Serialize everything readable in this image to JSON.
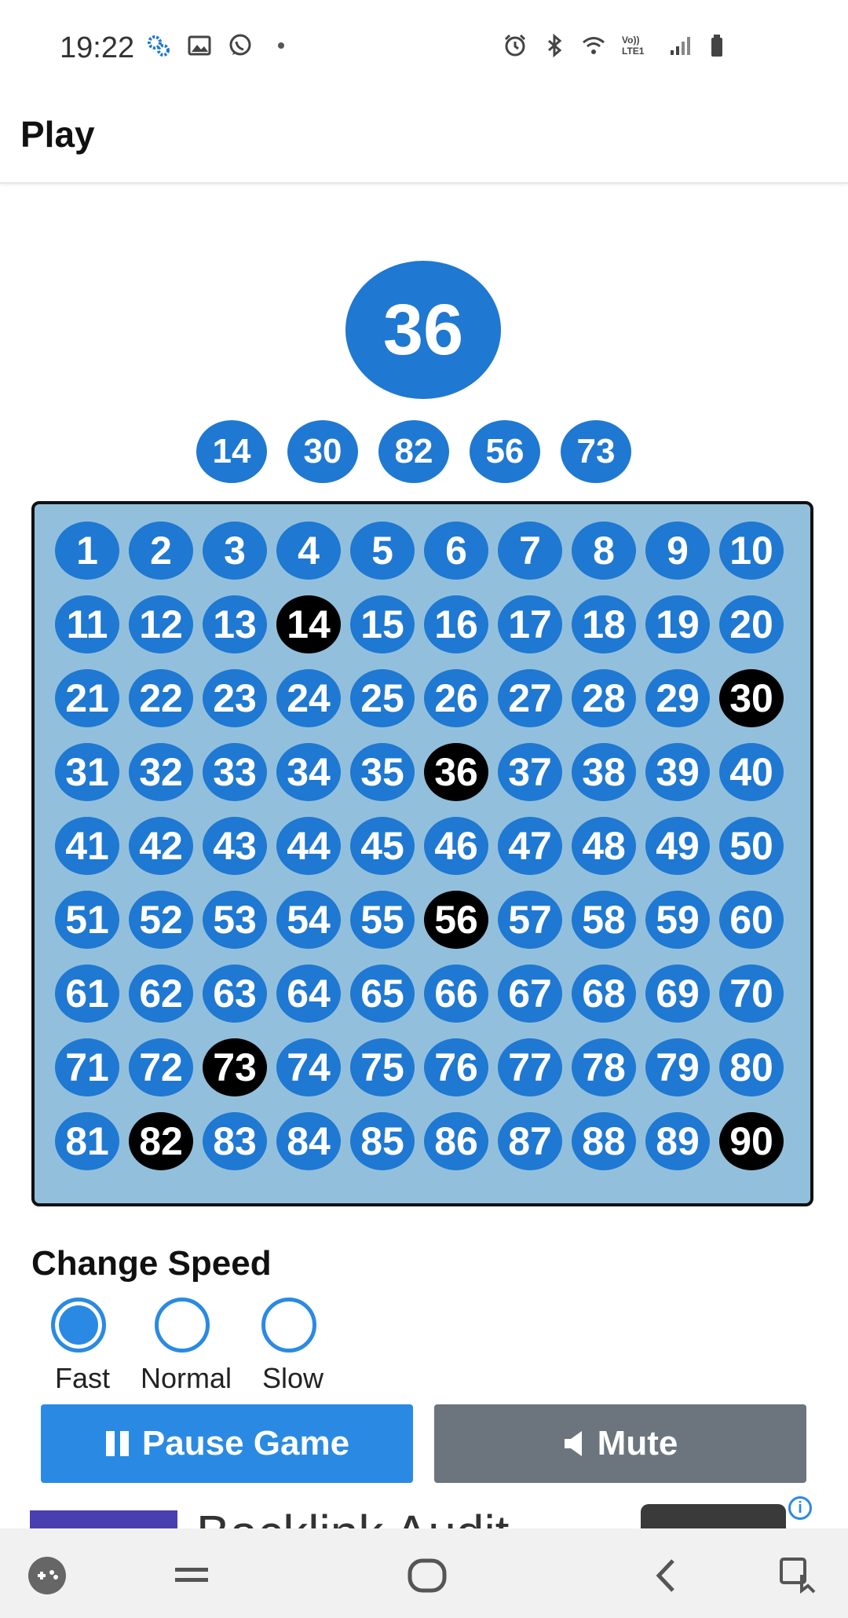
{
  "status_bar": {
    "time": "19:22",
    "left_icons": [
      "settings-icon",
      "gallery-icon",
      "whatsapp-icon",
      "dot-icon"
    ],
    "right_icons": [
      "alarm-icon",
      "bluetooth-icon",
      "wifi-icon",
      "volte-icon",
      "signal-icon",
      "battery-icon"
    ],
    "volte_text": "Vo)) LTE1"
  },
  "header": {
    "title": "Play"
  },
  "current_number": "36",
  "recent_numbers": [
    "14",
    "30",
    "82",
    "56",
    "73"
  ],
  "board": {
    "numbers": [
      "1",
      "2",
      "3",
      "4",
      "5",
      "6",
      "7",
      "8",
      "9",
      "10",
      "11",
      "12",
      "13",
      "14",
      "15",
      "16",
      "17",
      "18",
      "19",
      "20",
      "21",
      "22",
      "23",
      "24",
      "25",
      "26",
      "27",
      "28",
      "29",
      "30",
      "31",
      "32",
      "33",
      "34",
      "35",
      "36",
      "37",
      "38",
      "39",
      "40",
      "41",
      "42",
      "43",
      "44",
      "45",
      "46",
      "47",
      "48",
      "49",
      "50",
      "51",
      "52",
      "53",
      "54",
      "55",
      "56",
      "57",
      "58",
      "59",
      "60",
      "61",
      "62",
      "63",
      "64",
      "65",
      "66",
      "67",
      "68",
      "69",
      "70",
      "71",
      "72",
      "73",
      "74",
      "75",
      "76",
      "77",
      "78",
      "79",
      "80",
      "81",
      "82",
      "83",
      "84",
      "85",
      "86",
      "87",
      "88",
      "89",
      "90"
    ],
    "called": [
      "14",
      "30",
      "36",
      "56",
      "73",
      "82",
      "90"
    ]
  },
  "speed": {
    "title": "Change Speed",
    "options": [
      "Fast",
      "Normal",
      "Slow"
    ],
    "selected": "Fast"
  },
  "buttons": {
    "pause_label": "Pause Game",
    "mute_label": "Mute"
  },
  "ad": {
    "text": "Backlink Audit"
  },
  "colors": {
    "ball_blue": "#1f78d1",
    "called_black": "#000000",
    "board_bg": "#92c0dc",
    "pause_button": "#2a8ae3",
    "mute_button": "#6c757d"
  }
}
